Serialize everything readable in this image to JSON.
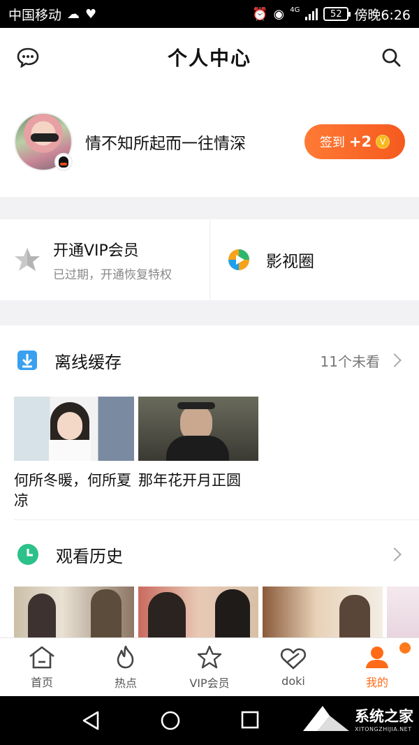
{
  "status_bar": {
    "carrier": "中国移动",
    "battery": "52",
    "time": "傍晚6:26",
    "network": "4G"
  },
  "header": {
    "title": "个人中心"
  },
  "profile": {
    "nickname": "情不知所起而一往情深",
    "checkin_label": "签到",
    "checkin_bonus": "+2",
    "coin_glyph": "V"
  },
  "quick": {
    "vip_title": "开通VIP会员",
    "vip_subtitle": "已过期，开通恢复特权",
    "circle_label": "影视圈"
  },
  "offline": {
    "title": "离线缓存",
    "meta": "11个未看",
    "items": [
      {
        "title": "何所冬暖，何所夏凉"
      },
      {
        "title": "那年花开月正圆"
      }
    ]
  },
  "history": {
    "title": "观看历史"
  },
  "tabs": [
    {
      "label": "首页"
    },
    {
      "label": "热点"
    },
    {
      "label": "VIP会员"
    },
    {
      "label": "doki"
    },
    {
      "label": "我的"
    }
  ],
  "watermark": {
    "title": "系统之家",
    "url": "XITONGZHIJIA.NET"
  },
  "colors": {
    "accent": "#ff6a18",
    "checkin": "#f55a1f",
    "download_blue": "#3aa0ee",
    "history_green": "#2cc18a"
  }
}
